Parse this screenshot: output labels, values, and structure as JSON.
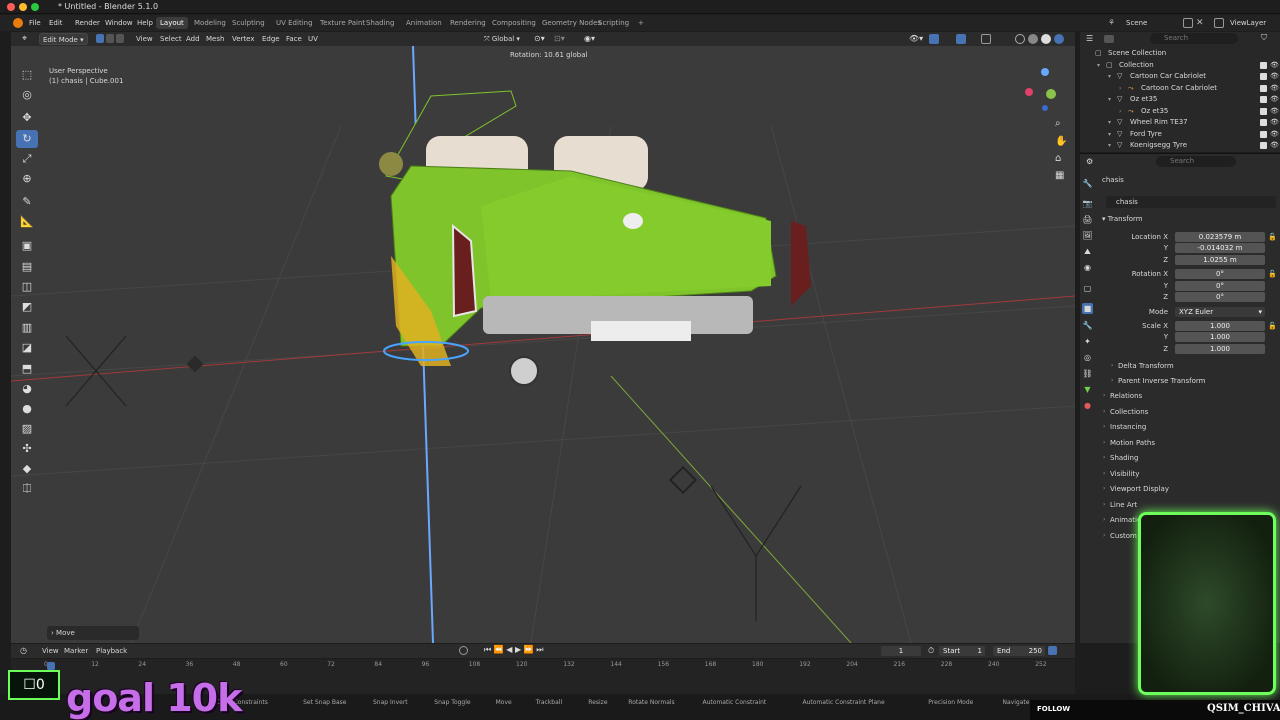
{
  "window": {
    "title": "* Untitled - Blender 5.1.0"
  },
  "menu": {
    "items": [
      "File",
      "Edit",
      "Render",
      "Window",
      "Help"
    ],
    "workspaces": [
      "Layout",
      "Modeling",
      "Sculpting",
      "UV Editing",
      "Texture Paint",
      "Shading",
      "Animation",
      "Rendering",
      "Compositing",
      "Geometry Nodes",
      "Scripting"
    ],
    "active_workspace": "Layout",
    "add_tab": "+",
    "scene": "Scene",
    "view_layer": "ViewLayer"
  },
  "viewport_header": {
    "mode": "Edit Mode",
    "menus": [
      "View",
      "Select",
      "Add",
      "Mesh",
      "Vertex",
      "Edge",
      "Face",
      "UV"
    ],
    "orientation": "Global"
  },
  "viewport": {
    "perspective": "User Perspective",
    "object_info": "(1) chasis | Cube.001",
    "operator_text": "Rotation: 10.61 global",
    "last_op": "Move"
  },
  "outliner": {
    "search_placeholder": "Search",
    "rows": [
      {
        "label": "Scene Collection",
        "indent": 0
      },
      {
        "label": "Collection",
        "indent": 1
      },
      {
        "label": "Cartoon Car Cabriolet",
        "indent": 2
      },
      {
        "label": "Cartoon Car Cabriolet",
        "indent": 3
      },
      {
        "label": "Oz et35",
        "indent": 2
      },
      {
        "label": "Oz et35",
        "indent": 3
      },
      {
        "label": "Wheel Rim TE37",
        "indent": 2
      },
      {
        "label": "Ford Tyre",
        "indent": 2
      },
      {
        "label": "Koenigsegg Tyre",
        "indent": 2
      }
    ]
  },
  "properties": {
    "search_placeholder": "Search",
    "breadcrumb": "chasis",
    "object_name": "chasis",
    "transform_label": "Transform",
    "location_label": "Location X",
    "location": [
      "0.023579 m",
      "-0.014032 m",
      "1.0255 m"
    ],
    "rotation_label": "Rotation X",
    "rotation": [
      "0°",
      "0°",
      "0°"
    ],
    "mode_label": "Mode",
    "mode": "XYZ Euler",
    "scale_label": "Scale X",
    "scale": [
      "1.000",
      "1.000",
      "1.000"
    ],
    "y_label": "Y",
    "z_label": "Z",
    "sub_sections": [
      "Delta Transform",
      "Parent Inverse Transform"
    ],
    "sections": [
      "Relations",
      "Collections",
      "Instancing",
      "Motion Paths",
      "Shading",
      "Visibility",
      "Viewport Display",
      "Line Art",
      "Animation",
      "Custom Properties"
    ]
  },
  "timeline": {
    "menus": [
      "View",
      "Marker",
      "Playback"
    ],
    "current_frame": "1",
    "start_label": "Start",
    "start": "1",
    "end_label": "End",
    "end": "250",
    "ticks": [
      "0",
      "12",
      "24",
      "36",
      "48",
      "60",
      "72",
      "84",
      "96",
      "108",
      "120",
      "132",
      "144",
      "156",
      "168",
      "180",
      "192",
      "204",
      "216",
      "228",
      "240",
      "252"
    ]
  },
  "statusbar": {
    "items": [
      "Clear Constraints",
      "Set Snap Base",
      "Snap Invert",
      "Snap Toggle",
      "Move",
      "Trackball",
      "Resize",
      "Rotate Normals",
      "Automatic Constraint",
      "Automatic Constraint Plane",
      "Precision Mode",
      "Navigate"
    ]
  },
  "overlay": {
    "counter": "0",
    "goal": "goal 10k",
    "follow": "FOLLOW",
    "channel": "QSIM_CHIVA"
  },
  "colors": {
    "accent": "#4772b3",
    "car_body": "#7ec42a",
    "webcam_border": "#6dff5a",
    "goal_text": "#c56ee8",
    "x_axis": "#c0392b",
    "y_axis": "#8bc34a",
    "z_axis": "#6aa8ff"
  }
}
